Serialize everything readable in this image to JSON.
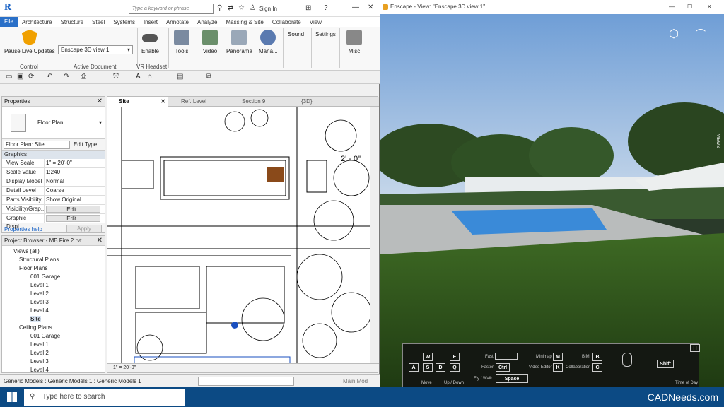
{
  "revit": {
    "search_placeholder": "Type a keyword or phrase",
    "sign_in": "Sign In",
    "menu": [
      "File",
      "Architecture",
      "Structure",
      "Steel",
      "Systems",
      "Insert",
      "Annotate",
      "Analyze",
      "Massing & Site",
      "Collaborate",
      "View"
    ],
    "ribbon": {
      "pause": "Pause Live Updates",
      "doc_select": "Enscape 3D view 1",
      "enable": "Enable",
      "tools": "Tools",
      "video": "Video",
      "panorama": "Panorama",
      "manage": "Mana...",
      "sound": "Sound",
      "settings": "Settings",
      "misc": "Misc",
      "panel_control": "Control",
      "panel_active_doc": "Active Document",
      "panel_vr": "VR Headset"
    },
    "properties": {
      "title": "Properties",
      "type_name": "Floor Plan",
      "selector": "Floor Plan: Site",
      "edit_type": "Edit Type",
      "group": "Graphics",
      "rows": [
        {
          "k": "View Scale",
          "v": "1\" = 20'-0\""
        },
        {
          "k": "Scale Value",
          "v": "1:240"
        },
        {
          "k": "Display Model",
          "v": "Normal"
        },
        {
          "k": "Detail Level",
          "v": "Coarse"
        },
        {
          "k": "Parts Visibility",
          "v": "Show Original"
        },
        {
          "k": "Visibility/Grap...",
          "v": "Edit..."
        },
        {
          "k": "Graphic Displ...",
          "v": "Edit..."
        }
      ],
      "help": "Properties help",
      "apply": "Apply"
    },
    "browser": {
      "title": "Project Browser - MB Fire 2.rvt",
      "nodes": [
        "Views (all)",
        "Structural Plans",
        "Floor Plans",
        "001 Garage",
        "Level 1",
        "Level 2",
        "Level 3",
        "Level 4",
        "Site",
        "Ceiling Plans",
        "001 Garage",
        "Level 1",
        "Level 2",
        "Level 3",
        "Level 4"
      ]
    },
    "tabs": [
      "Site",
      "Ref. Level",
      "Section 9",
      "{3D}"
    ],
    "view_scale": "1\" = 20'-0\"",
    "dim_label": "2' - 0\"",
    "status": "Generic Models : Generic Models 1 : Generic Models 1",
    "main_model": "Main Mod"
  },
  "enscape": {
    "title": "Enscape - View: \"Enscape 3D view 1\"",
    "views_label": "VIEWS",
    "hud": {
      "keys": [
        "W",
        "E",
        "A",
        "S",
        "D",
        "Q",
        "Ctrl",
        "Space",
        "M",
        "B",
        "K",
        "C",
        "Shift",
        "H"
      ],
      "labels": [
        "Move",
        "Up / Down",
        "Fast",
        "Faster",
        "Fly / Walk",
        "Minimap",
        "Video Editor",
        "BIM",
        "Collaboration",
        "Time of Day"
      ]
    }
  },
  "taskbar": {
    "search": "Type here to search",
    "brand": "CADNeeds.com"
  }
}
